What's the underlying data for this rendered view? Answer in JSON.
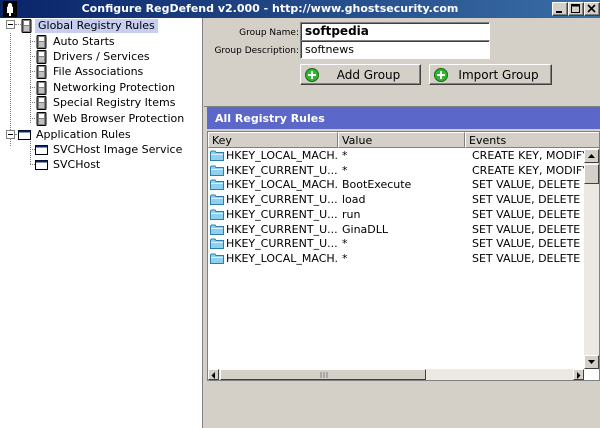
{
  "window": {
    "title": "Configure RegDefend v2.000 - http://www.ghostsecurity.com"
  },
  "tree": {
    "global_rules": {
      "label": "Global Registry Rules",
      "items": [
        {
          "label": "Auto Starts"
        },
        {
          "label": "Drivers / Services"
        },
        {
          "label": "File Associations"
        },
        {
          "label": "Networking Protection"
        },
        {
          "label": "Special Registry Items"
        },
        {
          "label": "Web Browser Protection"
        }
      ]
    },
    "app_rules": {
      "label": "Application Rules",
      "items": [
        {
          "label": "SVCHost Image Service"
        },
        {
          "label": "SVCHost"
        }
      ]
    }
  },
  "form": {
    "group_name_label": "Group Name:",
    "group_name_value": "softpedia",
    "group_desc_label": "Group Description:",
    "group_desc_value": "softnews",
    "add_group_label": "Add Group",
    "import_group_label": "Import Group"
  },
  "rules": {
    "header": "All Registry Rules",
    "columns": [
      "Key",
      "Value",
      "Events"
    ],
    "rows": [
      {
        "key": "HKEY_LOCAL_MACH...",
        "value": "*",
        "events": "CREATE KEY, MODIFY"
      },
      {
        "key": "HKEY_CURRENT_U...",
        "value": "*",
        "events": "CREATE KEY, MODIFY"
      },
      {
        "key": "HKEY_LOCAL_MACH...",
        "value": "BootExecute",
        "events": "SET VALUE, DELETE V"
      },
      {
        "key": "HKEY_CURRENT_U...",
        "value": "load",
        "events": "SET VALUE, DELETE V"
      },
      {
        "key": "HKEY_CURRENT_U...",
        "value": "run",
        "events": "SET VALUE, DELETE V"
      },
      {
        "key": "HKEY_CURRENT_U...",
        "value": "GinaDLL",
        "events": "SET VALUE, DELETE V"
      },
      {
        "key": "HKEY_CURRENT_U...",
        "value": "*",
        "events": "SET VALUE, DELETE V"
      },
      {
        "key": "HKEY_LOCAL_MACH...",
        "value": "*",
        "events": "SET VALUE, DELETE V"
      }
    ]
  },
  "colors": {
    "titlebar": "#0a246a",
    "panel_header": "#5b67c9",
    "selection": "#c6cff2",
    "button_icon": "#2fb52f"
  }
}
